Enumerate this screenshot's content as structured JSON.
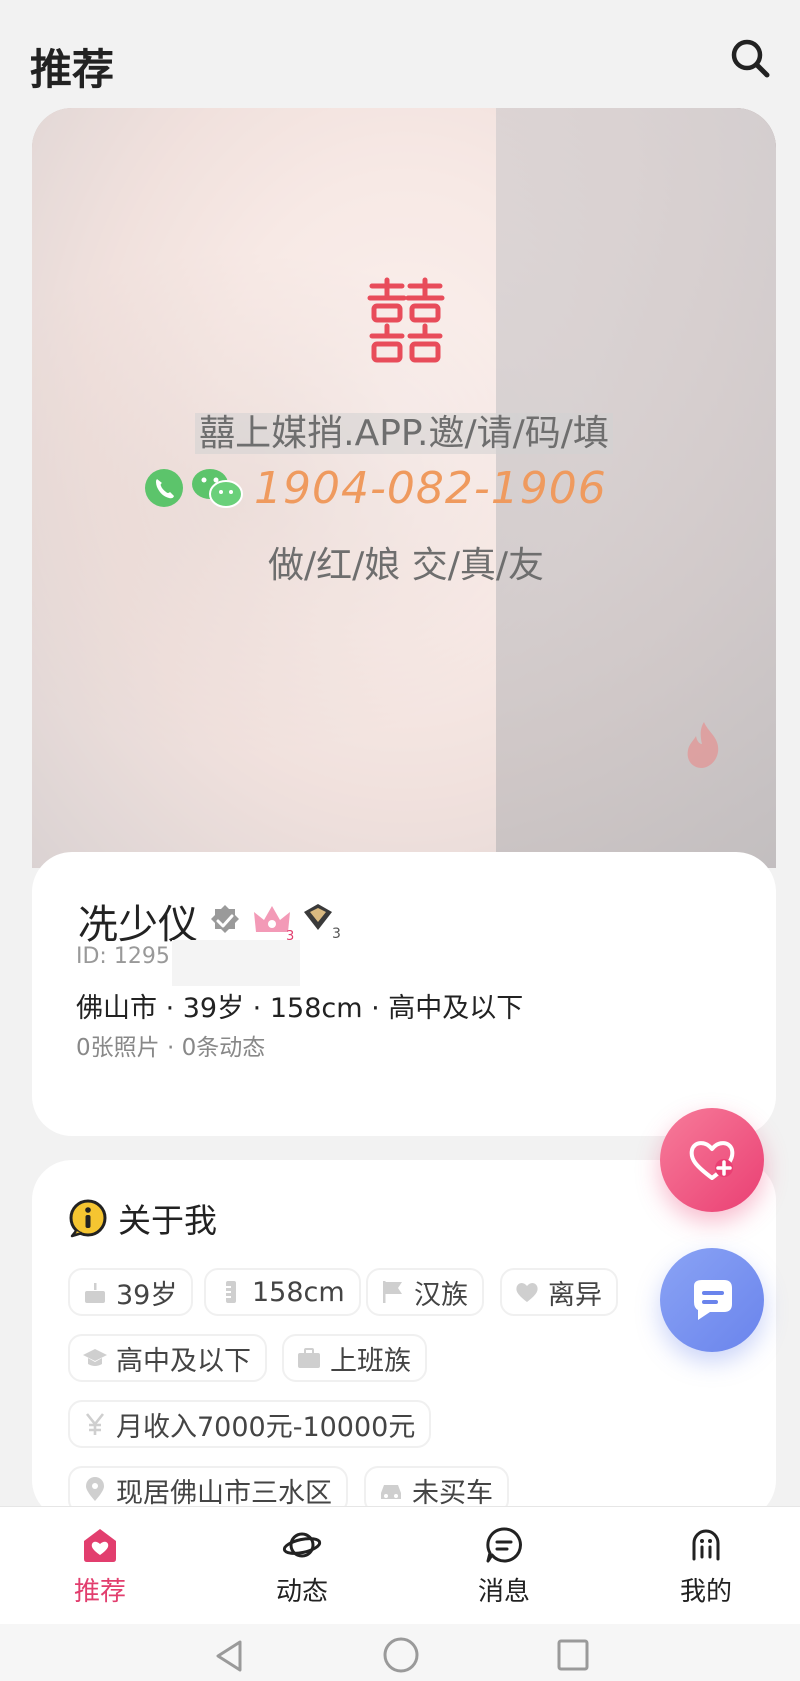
{
  "header": {
    "title": "推荐"
  },
  "photo": {
    "watermark_line1": "囍上媒捎.APP.邀/请/码/填",
    "watermark_phone": "1904-082-1906",
    "watermark_line3": "做/红/娘 交/真/友"
  },
  "profile": {
    "name": "冼少仪",
    "id_label": "ID: 1295",
    "summary": "佛山市 · 39岁 · 158cm · 高中及以下",
    "counts": "0张照片 · 0条动态",
    "badges": {
      "crown_level": "3",
      "vip_level": "3"
    }
  },
  "about": {
    "title": "关于我",
    "tags": [
      {
        "icon": "cake-icon",
        "label": "39岁"
      },
      {
        "icon": "height-icon",
        "label": "158cm"
      },
      {
        "icon": "flag-icon",
        "label": "汉族"
      },
      {
        "icon": "heart-icon",
        "label": "离异"
      },
      {
        "icon": "graduation-cap-icon",
        "label": "高中及以下"
      },
      {
        "icon": "briefcase-icon",
        "label": "上班族"
      },
      {
        "icon": "yen-icon",
        "label": "月收入7000元-10000元"
      },
      {
        "icon": "location-icon",
        "label": "现居佛山市三水区"
      },
      {
        "icon": "car-icon",
        "label": "未买车"
      }
    ]
  },
  "tabbar": {
    "items": [
      {
        "label": "推荐",
        "icon": "home-heart-icon",
        "active": true
      },
      {
        "label": "动态",
        "icon": "planet-icon",
        "active": false
      },
      {
        "label": "消息",
        "icon": "message-icon",
        "active": false
      },
      {
        "label": "我的",
        "icon": "user-icon",
        "active": false
      }
    ]
  },
  "colors": {
    "accent": "#e23e6e",
    "like_button": "#ea3f73",
    "chat_button": "#6a84ec",
    "watermark_phone": "#ef9a5e"
  }
}
